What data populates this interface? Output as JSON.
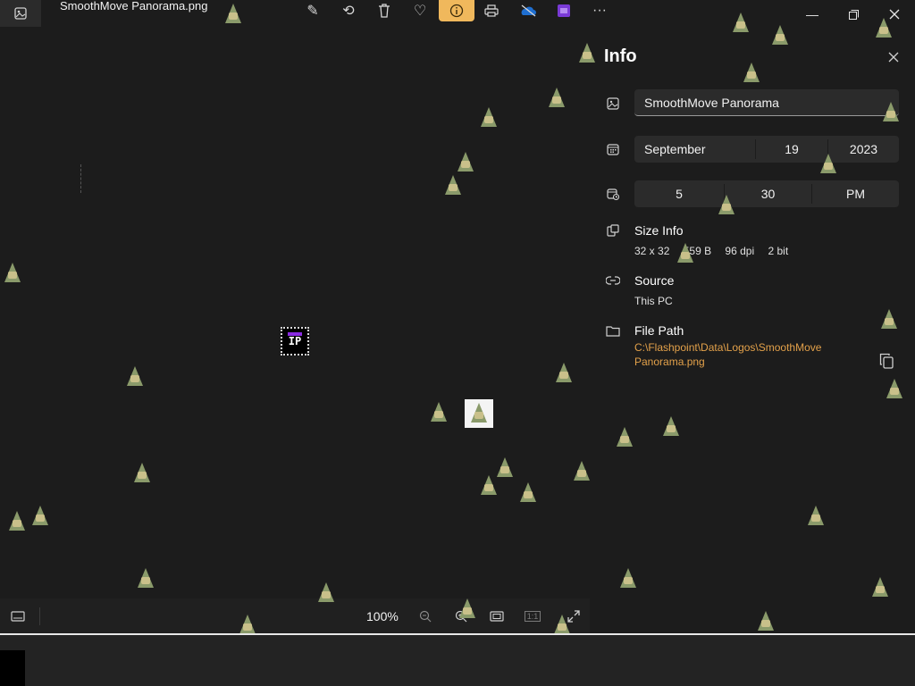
{
  "window": {
    "file_name": "SmoothMove Panorama.png",
    "minimize_icon": "minimize-icon",
    "maximize_icon": "maximize-icon",
    "close_icon": "close-icon"
  },
  "toolbar": {
    "buttons": [
      {
        "icon": "edit-image-icon"
      },
      {
        "icon": "rotate-icon"
      },
      {
        "icon": "delete-icon"
      },
      {
        "icon": "favorite-icon"
      },
      {
        "icon": "info-icon",
        "active": true
      },
      {
        "icon": "print-icon"
      },
      {
        "icon": "onedrive-icon"
      },
      {
        "icon": "clipchamp-icon"
      },
      {
        "icon": "more-icon"
      }
    ],
    "more_label": "···"
  },
  "zoombar": {
    "zoom_label": "100%",
    "zoom_out_label": "−",
    "zoom_in_label": "+",
    "actual_size_label": "1:1"
  },
  "info": {
    "title": "Info",
    "name_value": "SmoothMove Panorama",
    "date": {
      "month": "September",
      "day": "19",
      "year": "2023"
    },
    "time": {
      "hour": "5",
      "minute": "30",
      "period": "PM"
    },
    "size_info": {
      "title": "Size Info",
      "dimensions": "32 x 32",
      "bytes": "559 B",
      "dpi": "96 dpi",
      "bit": "2 bit"
    },
    "source": {
      "title": "Source",
      "value": "This PC"
    },
    "file_path": {
      "title": "File Path",
      "value": "C:\\Flashpoint\\Data\\Logos\\SmoothMove Panorama.png"
    }
  },
  "image": {
    "thumb_text": "IP"
  },
  "colors": {
    "background": "#1c1c1c",
    "panel_field": "#2b2b2b",
    "accent": "#f0b85c",
    "path_link": "#e3a14a"
  }
}
